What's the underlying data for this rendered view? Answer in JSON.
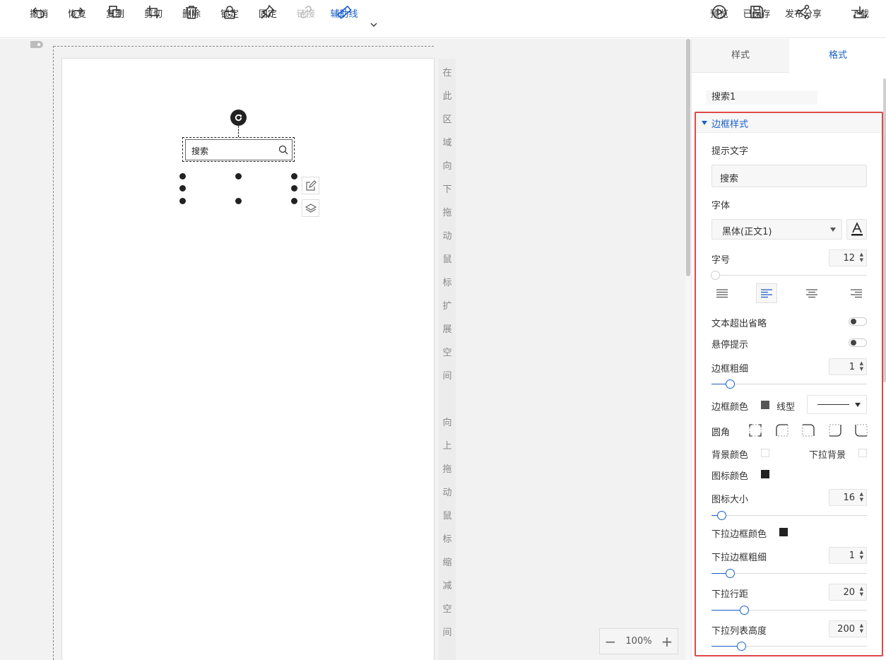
{
  "toolbar": {
    "undo": "撤销",
    "redo": "恢复",
    "copy": "复制",
    "cut": "剪切",
    "delete": "删除",
    "lock": "锁定",
    "pin": "固定",
    "link": "链接",
    "guide": "辅助线",
    "preview": "预览",
    "saved": "已保存",
    "share": "发布分享",
    "download": "下载"
  },
  "canvas": {
    "hint_expand": [
      "在",
      "此",
      "区",
      "域",
      "向",
      "下",
      "拖",
      "动",
      "鼠",
      "标",
      "扩",
      "展",
      "空",
      "间"
    ],
    "hint_shrink": [
      "向",
      "上",
      "拖",
      "动",
      "鼠",
      "标",
      "缩",
      "减",
      "空",
      "间"
    ],
    "widget_text": "搜索",
    "zoom": {
      "minus": "−",
      "value": "100%",
      "plus": "+"
    }
  },
  "panel": {
    "tabs": {
      "style": "样式",
      "format": "格式"
    },
    "component_name": "搜索1",
    "section_title": "边框样式",
    "hint_text_label": "提示文字",
    "hint_text_value": "搜索",
    "font_label": "字体",
    "font_value": "黑体(正文1)",
    "font_size_label": "字号",
    "font_size_value": "12",
    "text_ellipsis_label": "文本超出省略",
    "hover_tip_label": "悬停提示",
    "border_width_label": "边框粗细",
    "border_width_value": "1",
    "border_color_label": "边框颜色",
    "line_type_label": "线型",
    "radius_label": "圆角",
    "bg_color_label": "背景颜色",
    "dropdown_bg_label": "下拉背景",
    "icon_color_label": "图标颜色",
    "icon_size_label": "图标大小",
    "icon_size_value": "16",
    "dropdown_border_color_label": "下拉边框颜色",
    "dropdown_border_width_label": "下拉边框粗细",
    "dropdown_border_width_value": "1",
    "dropdown_line_height_label": "下拉行距",
    "dropdown_line_height_value": "20",
    "dropdown_list_height_label": "下拉列表高度",
    "dropdown_list_height_value": "200"
  },
  "colors": {
    "accent": "#1a5fc8",
    "highlight_border": "#e04848",
    "border_color_swatch": "#555555",
    "icon_color_swatch": "#222222",
    "dropdown_border_swatch": "#222222"
  }
}
